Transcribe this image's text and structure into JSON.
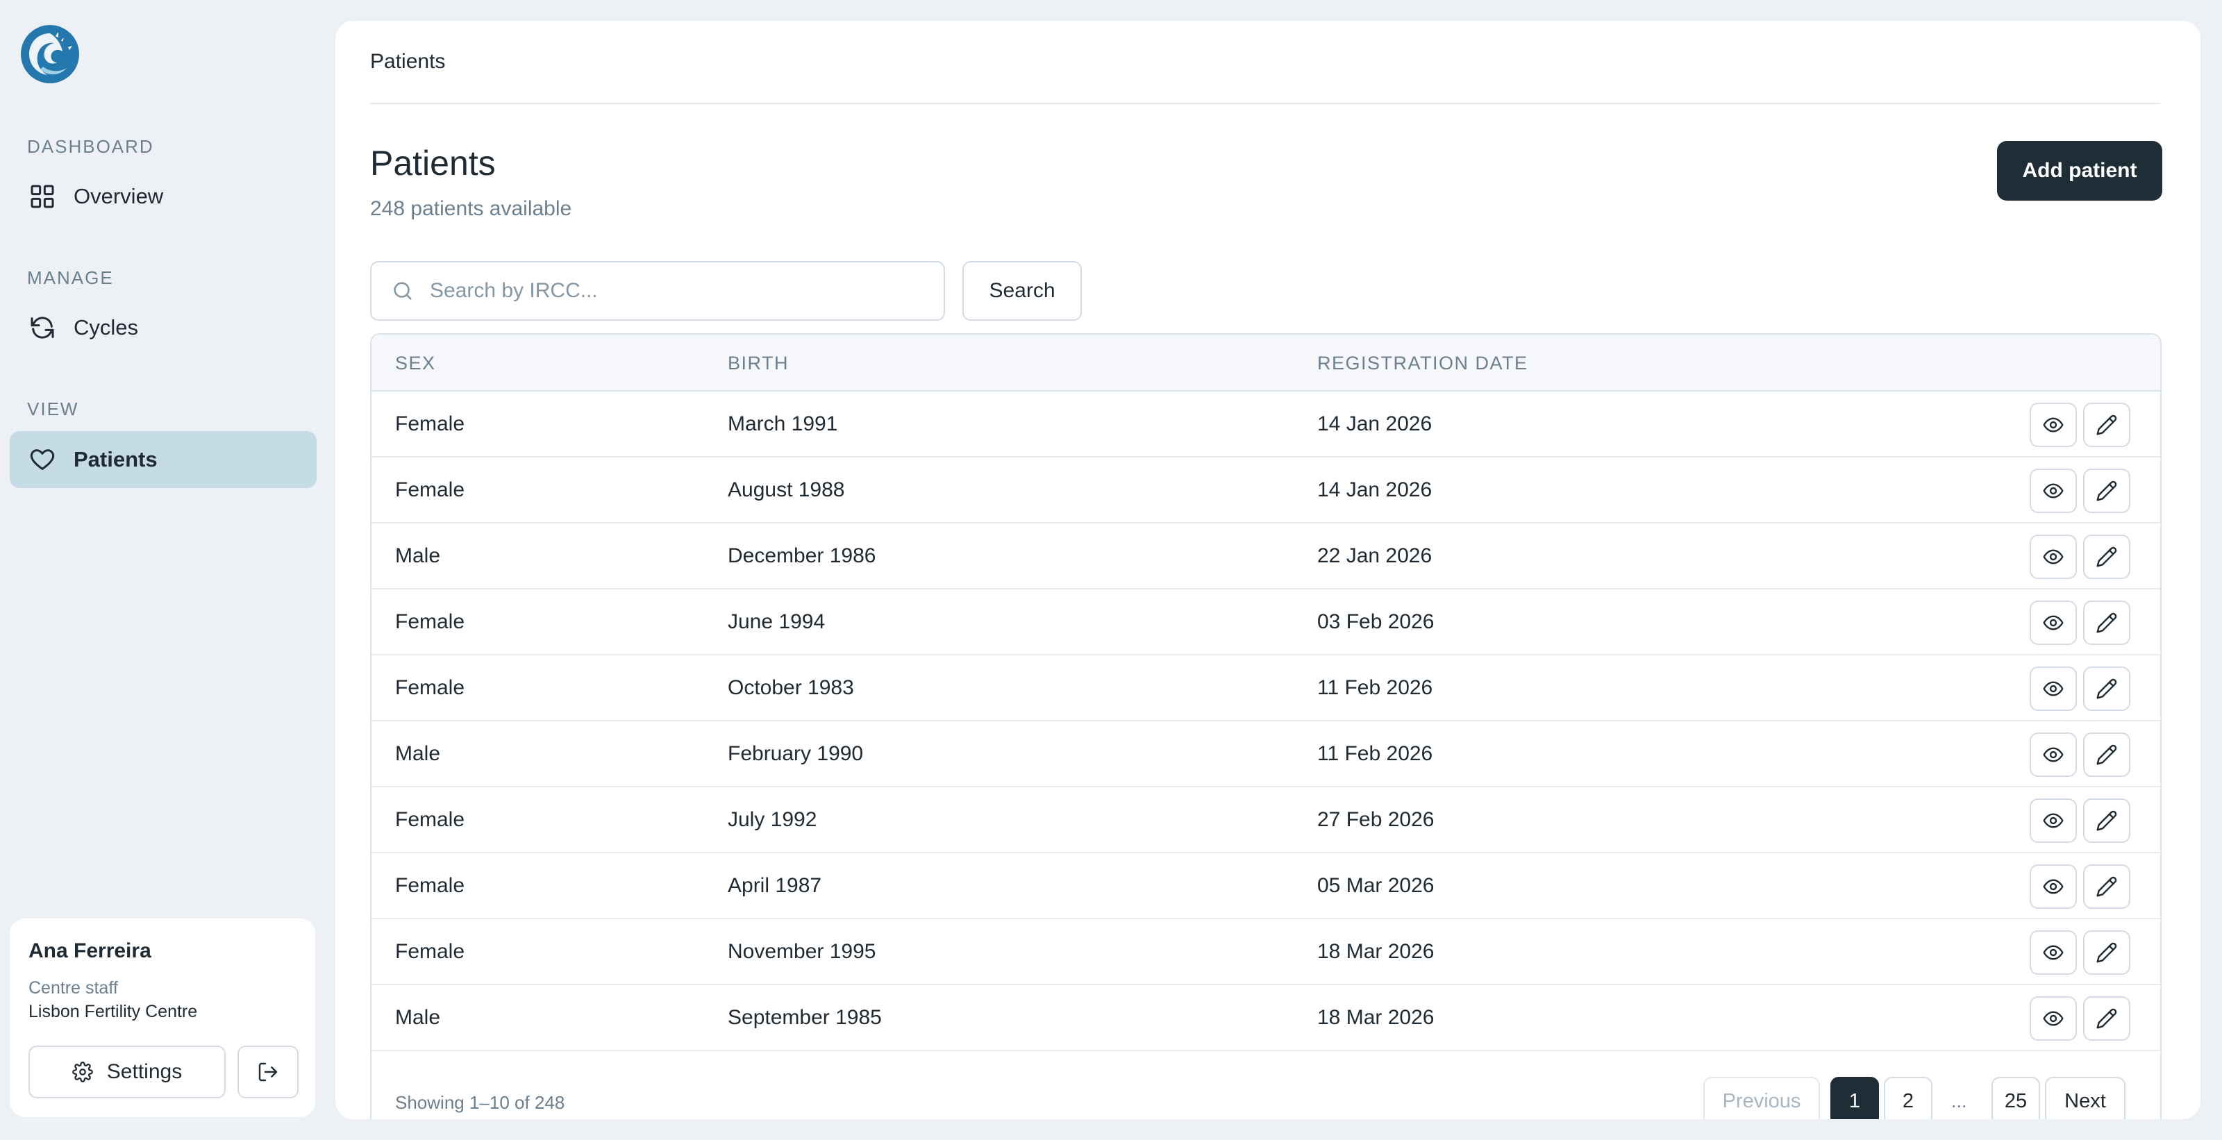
{
  "sidebar": {
    "logo": "clinic-logo",
    "sections": [
      {
        "label": "DASHBOARD",
        "items": [
          {
            "label": "Overview",
            "icon": "grid-icon"
          }
        ]
      },
      {
        "label": "MANAGE",
        "items": [
          {
            "label": "Cycles",
            "icon": "refresh-icon"
          }
        ]
      },
      {
        "label": "VIEW",
        "items": [
          {
            "label": "Patients",
            "icon": "heart-icon",
            "active": true
          }
        ]
      }
    ],
    "user": {
      "name": "Ana Ferreira",
      "role": "Centre staff",
      "centre": "Lisbon Fertility Centre",
      "settings_label": "Settings"
    }
  },
  "main": {
    "breadcrumb": "Patients",
    "title": "Patients",
    "subtitle": "248 patients available",
    "add_button": "Add patient",
    "search": {
      "placeholder": "Search by IRCC...",
      "value": "",
      "button": "Search"
    },
    "table": {
      "headers": [
        "SEX",
        "BIRTH",
        "REGISTRATION DATE"
      ],
      "rows": [
        [
          "Female",
          "March 1991",
          "14 Jan 2026"
        ],
        [
          "Female",
          "August 1988",
          "14 Jan 2026"
        ],
        [
          "Male",
          "December 1986",
          "22 Jan 2026"
        ],
        [
          "Female",
          "June 1994",
          "03 Feb 2026"
        ],
        [
          "Female",
          "October 1983",
          "11 Feb 2026"
        ],
        [
          "Male",
          "February 1990",
          "11 Feb 2026"
        ],
        [
          "Female",
          "July 1992",
          "27 Feb 2026"
        ],
        [
          "Female",
          "April 1987",
          "05 Mar 2026"
        ],
        [
          "Female",
          "November 1995",
          "18 Mar 2026"
        ],
        [
          "Male",
          "September 1985",
          "18 Mar 2026"
        ]
      ]
    },
    "pagination": {
      "showing": "Showing 1–10 of 248",
      "previous": "Previous",
      "pages": [
        "1",
        "2",
        "...",
        "25"
      ],
      "current": "1",
      "next": "Next"
    }
  },
  "colors": {
    "background": "#edf1f6",
    "active_nav": "#c5dce6",
    "primary_dark": "#1f2d36",
    "muted_text": "#6b7f8f",
    "logo_blue": "#2478ad"
  }
}
